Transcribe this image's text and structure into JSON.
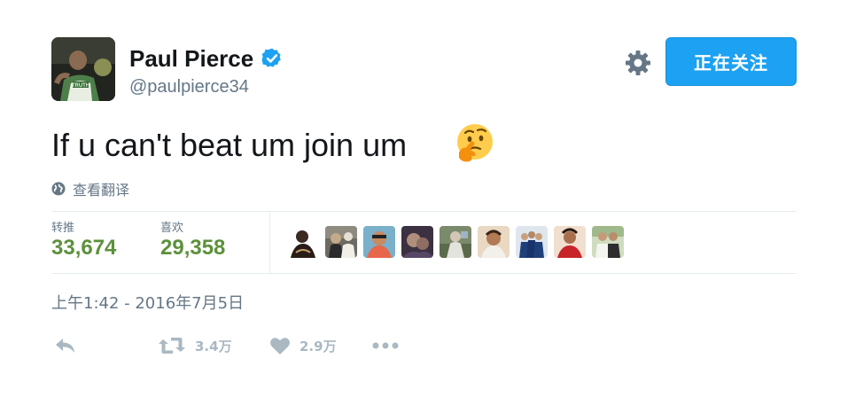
{
  "profile": {
    "display_name": "Paul Pierce",
    "handle": "@paulpierce34",
    "avatar_shirt_text": "TRUTH"
  },
  "header": {
    "follow_label": "正在关注",
    "settings_icon": "gear-icon",
    "verified_icon": "verified-badge-icon"
  },
  "tweet": {
    "text": "If u can't beat um join um",
    "emoji": "thinking-face-emoji",
    "translate_label": "查看翻译",
    "timestamp": "上午1:42 - 2016年7月5日"
  },
  "stats": {
    "retweets_label": "转推",
    "retweets_value": "33,674",
    "likes_label": "喜欢",
    "likes_value": "29,358"
  },
  "likers": [
    {
      "name": "liker-avatar-1"
    },
    {
      "name": "liker-avatar-2"
    },
    {
      "name": "liker-avatar-3"
    },
    {
      "name": "liker-avatar-4"
    },
    {
      "name": "liker-avatar-5"
    },
    {
      "name": "liker-avatar-6"
    },
    {
      "name": "liker-avatar-7"
    },
    {
      "name": "liker-avatar-8"
    },
    {
      "name": "liker-avatar-9"
    }
  ],
  "actions": {
    "reply_icon": "reply-icon",
    "retweet_icon": "retweet-icon",
    "retweet_count": "3.4万",
    "like_icon": "heart-icon",
    "like_count": "2.9万",
    "more_icon": "more-dots-icon"
  },
  "colors": {
    "accent": "#1da1f2",
    "stat_green": "#5c913b",
    "muted": "#657786",
    "action_gray": "#aab8c2",
    "divider": "#e6ecf0"
  }
}
